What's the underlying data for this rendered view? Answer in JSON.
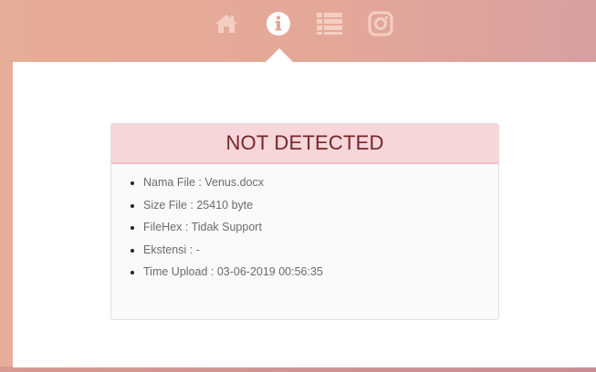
{
  "nav": {
    "items": [
      {
        "icon": "home-icon"
      },
      {
        "icon": "info-icon"
      },
      {
        "icon": "list-icon"
      },
      {
        "icon": "instagram-icon"
      }
    ],
    "active_color": "#ffffff",
    "inactive_color": "#f5cec2"
  },
  "result": {
    "title": "NOT DETECTED",
    "details": [
      "Nama File : Venus.docx",
      "Size File : 25410 byte",
      "FileHex : Tidak Support",
      "Ekstensi : -",
      "Time Upload : 03-06-2019 00:56:35"
    ]
  },
  "colors": {
    "header_bg": "#f6d6da",
    "title_text": "#7a2427",
    "frame": "#e4a899"
  }
}
